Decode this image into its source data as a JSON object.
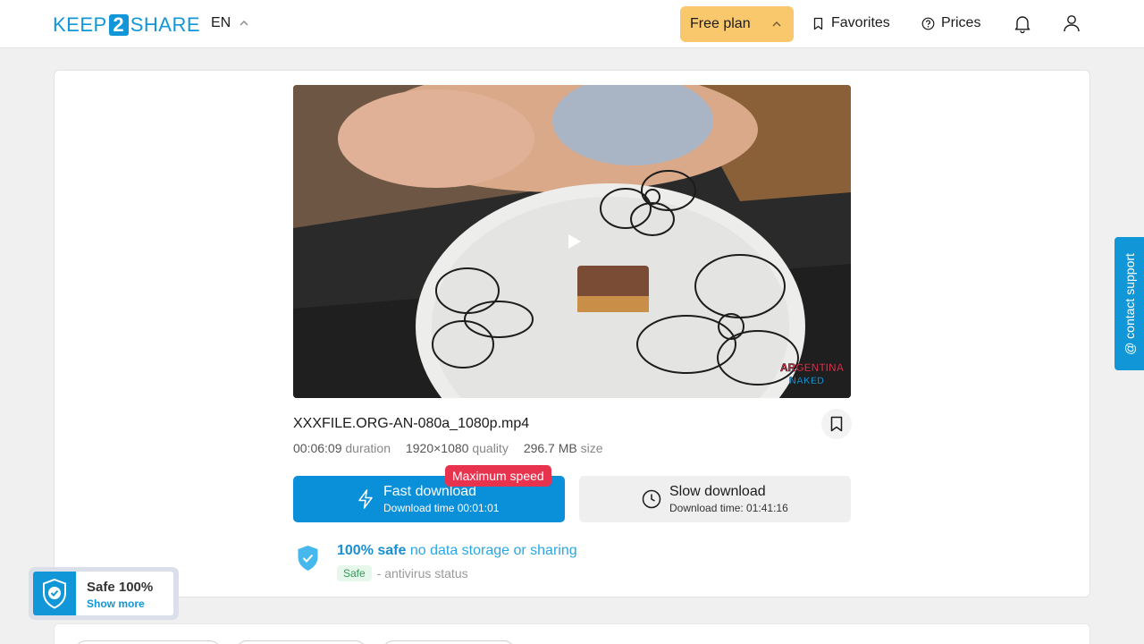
{
  "header": {
    "logo_left": "KEEP",
    "logo_mid": "2",
    "logo_right": "SHARE",
    "language": "EN",
    "plan_label": "Free plan",
    "favorites_label": "Favorites",
    "prices_label": "Prices"
  },
  "file": {
    "name": "XXXFILE.ORG-AN-080a_1080p.mp4",
    "duration_value": "00:06:09",
    "duration_label": "duration",
    "quality_value": "1920×1080",
    "quality_label": "quality",
    "size_value": "296.7 MB",
    "size_label": "size",
    "watermark_line1": "ARGENTINA",
    "watermark_line2": "NAKED"
  },
  "download": {
    "badge": "Maximum speed",
    "fast_title": "Fast download",
    "fast_sub": "Download time 00:01:01",
    "slow_title": "Slow download",
    "slow_sub": "Download time: 01:41:16"
  },
  "safety": {
    "bold": "100% safe",
    "rest": "no data storage or sharing",
    "pill": "Safe",
    "status": "- antivirus status"
  },
  "contact": {
    "label": "@ contact support"
  },
  "safe_widget": {
    "title": "Safe 100%",
    "link": "Show more"
  },
  "colors": {
    "brand_blue": "#1197d8",
    "plan_yellow": "#f9c86c",
    "badge_red": "#e8334f",
    "safe_green": "#2e9b55"
  }
}
